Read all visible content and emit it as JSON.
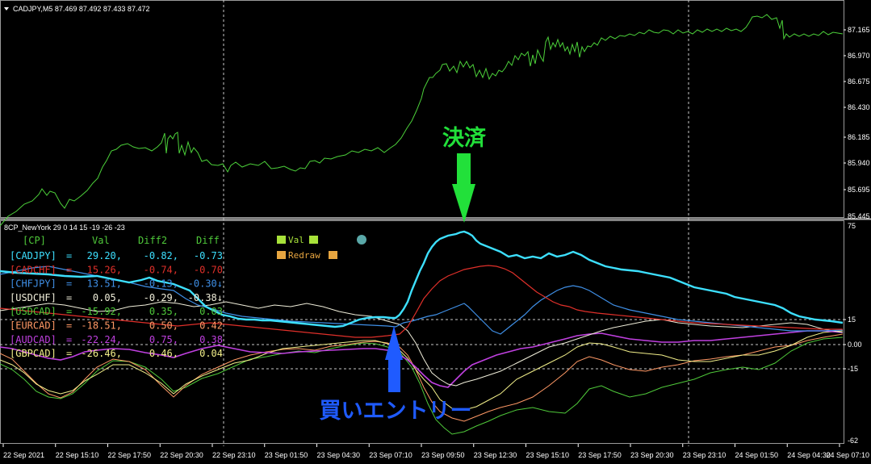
{
  "price_panel": {
    "header": "CADJPY,M5  87.469 87.492 87.433 87.472",
    "y_ticks": [
      "87.165",
      "86.970",
      "86.675",
      "86.430",
      "86.185",
      "85.940",
      "85.695",
      "85.445"
    ],
    "line_color": "#4cd13a"
  },
  "indicator_panel": {
    "header": "8CP_NewYork 29 0 14 15 -19 -26 -23",
    "y_ticks": [
      "75",
      "15",
      "0.00",
      "-15",
      "-62"
    ],
    "table_header": [
      "[CP]",
      "Val",
      "Diff2",
      "Diff"
    ],
    "rows": [
      {
        "pair": "[CADJPY]",
        "val": "29.20,",
        "diff2": "-0.82,",
        "diff": "-0.73",
        "color": "#3de0ff"
      },
      {
        "pair": "[CADCHF]",
        "val": "15.26,",
        "diff2": "-0.74,",
        "diff": "-0.70",
        "color": "#e0302a"
      },
      {
        "pair": "[CHFJPY]",
        "val": "13.51,",
        "diff2": "-0.13,",
        "diff": "-0.30↓",
        "color": "#3f8fe6"
      },
      {
        "pair": "[USDCHF]",
        "val": "0.05,",
        "diff2": "-0.29,",
        "diff": "-0.38↓",
        "color": "#f0eeda"
      },
      {
        "pair": "[USDCAD]",
        "val": "-15.92,",
        "diff2": "0.35,",
        "diff": "0.03",
        "color": "#4fc93a"
      },
      {
        "pair": "[EURCAD]",
        "val": "-18.51,",
        "diff2": "0.50,",
        "diff": "0.42",
        "color": "#ff9966"
      },
      {
        "pair": "[AUDCAD]",
        "val": "-22.24,",
        "diff2": "0.75,",
        "diff": "0.38",
        "color": "#c040e0"
      },
      {
        "pair": "[GBPCAD]",
        "val": "-26.46,",
        "diff2": "0.46,",
        "diff": "0.04",
        "color": "#f3f08a"
      }
    ],
    "legend": {
      "val_label": "Val",
      "redraw_label": "Redraw"
    }
  },
  "annotations": {
    "exit_label": "決済",
    "exit_color": "#22e03a",
    "entry_label": "買いエントリー",
    "entry_color": "#1f5bff"
  },
  "x_ticks": [
    "22 Sep 2021",
    "22 Sep 15:10",
    "22 Sep 17:50",
    "22 Sep 20:30",
    "22 Sep 23:10",
    "23 Sep 01:50",
    "23 Sep 04:30",
    "23 Sep 07:10",
    "23 Sep 09:50",
    "23 Sep 12:30",
    "23 Sep 15:10",
    "23 Sep 17:50",
    "23 Sep 20:30",
    "23 Sep 23:10",
    "24 Sep 01:50",
    "24 Sep 04:30",
    "24 Sep 07:10"
  ],
  "colors": {
    "grid_line": "#c8c8c8",
    "axis_text": "#ffffff",
    "panel_separator": "#b4b4b4"
  }
}
